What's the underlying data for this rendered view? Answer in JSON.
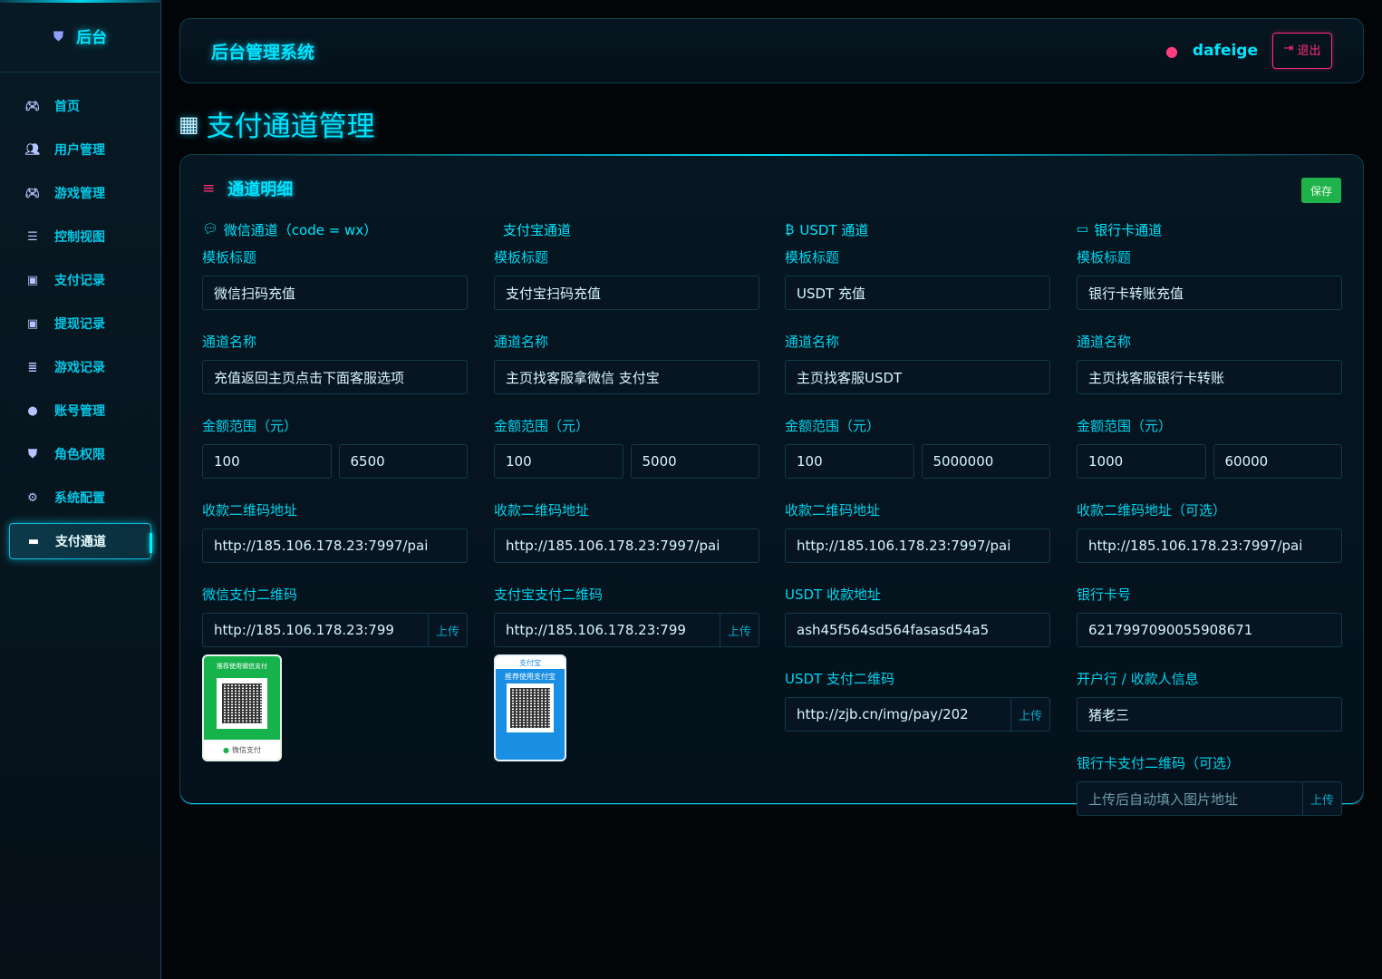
{
  "sidebar": {
    "brand": "后台",
    "items": [
      {
        "label": "首页",
        "icon": "gamepad"
      },
      {
        "label": "用户管理",
        "icon": "users"
      },
      {
        "label": "游戏管理",
        "icon": "gamepad"
      },
      {
        "label": "控制视图",
        "icon": "sliders"
      },
      {
        "label": "支付记录",
        "icon": "money"
      },
      {
        "label": "提现记录",
        "icon": "money"
      },
      {
        "label": "游戏记录",
        "icon": "list"
      },
      {
        "label": "账号管理",
        "icon": "user"
      },
      {
        "label": "角色权限",
        "icon": "shield"
      },
      {
        "label": "系统配置",
        "icon": "gear"
      },
      {
        "label": "支付通道",
        "icon": "card",
        "active": true
      }
    ]
  },
  "header": {
    "system_title": "后台管理系统",
    "username": "dafeige",
    "logout_label": "退出"
  },
  "page": {
    "title": "支付通道管理"
  },
  "card": {
    "title": "通道明细",
    "save_label": "保存"
  },
  "channels": {
    "wechat": {
      "title": "微信通道（code = wx）",
      "template_label": "模板标题",
      "template_value": "微信扫码充值",
      "name_label": "通道名称",
      "name_value": "充值返回主页点击下面客服选项",
      "range_label": "金额范围（元）",
      "range_min": "100",
      "range_max": "6500",
      "qr_url_label": "收款二维码地址",
      "qr_url_value": "http://185.106.178.23:7997/pai",
      "pay_qr_label": "微信支付二维码",
      "pay_qr_value": "http://185.106.178.23:799",
      "upload_label": "上传",
      "qr_image_top": "推荐使用微信支付",
      "qr_image_bottom": "微信支付"
    },
    "alipay": {
      "title": "支付宝通道",
      "template_label": "模板标题",
      "template_value": "支付宝扫码充值",
      "name_label": "通道名称",
      "name_value": "主页找客服拿微信 支付宝",
      "range_label": "金额范围（元）",
      "range_min": "100",
      "range_max": "5000",
      "qr_url_label": "收款二维码地址",
      "qr_url_value": "http://185.106.178.23:7997/pai",
      "pay_qr_label": "支付宝支付二维码",
      "pay_qr_value": "http://185.106.178.23:799",
      "upload_label": "上传",
      "qr_image_head": "支付宝",
      "qr_image_top": "推荐使用支付宝"
    },
    "usdt": {
      "title": "USDT 通道",
      "template_label": "模板标题",
      "template_value": "USDT 充值",
      "name_label": "通道名称",
      "name_value": "主页找客服USDT",
      "range_label": "金额范围（元）",
      "range_min": "100",
      "range_max": "5000000",
      "qr_url_label": "收款二维码地址",
      "qr_url_value": "http://185.106.178.23:7997/pai",
      "address_label": "USDT 收款地址",
      "address_value": "ash45f564sd564fasasd54a5",
      "pay_qr_label": "USDT 支付二维码",
      "pay_qr_value": "http://zjb.cn/img/pay/202",
      "upload_label": "上传"
    },
    "bank": {
      "title": "银行卡通道",
      "template_label": "模板标题",
      "template_value": "银行卡转账充值",
      "name_label": "通道名称",
      "name_value": "主页找客服银行卡转账",
      "range_label": "金额范围（元）",
      "range_min": "1000",
      "range_max": "60000",
      "qr_url_label": "收款二维码地址（可选）",
      "qr_url_value": "http://185.106.178.23:7997/pai",
      "card_label": "银行卡号",
      "card_value": "6217997090055908671",
      "holder_label": "开户行 / 收款人信息",
      "holder_value": "猪老三",
      "pay_qr_label": "银行卡支付二维码（可选）",
      "pay_qr_placeholder": "上传后自动填入图片地址",
      "upload_label": "上传"
    }
  },
  "colors": {
    "accent": "#00e5ff",
    "danger": "#ff2e7a",
    "success": "#20b24a"
  }
}
